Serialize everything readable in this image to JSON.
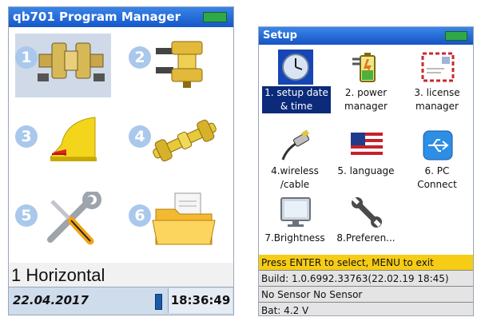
{
  "left_screen": {
    "title": "qb701 Program Manager",
    "tiles": [
      {
        "number": "1"
      },
      {
        "number": "2"
      },
      {
        "number": "3"
      },
      {
        "number": "4"
      },
      {
        "number": "5"
      },
      {
        "number": "6"
      }
    ],
    "selected_program": "1 Horizontal",
    "date": "22.04.2017",
    "time": "18:36:49"
  },
  "right_screen": {
    "title": "Setup",
    "items": [
      {
        "label_line1": "1. setup date",
        "label_line2": "& time",
        "icon": "clock-icon"
      },
      {
        "label_line1": "2. power",
        "label_line2": "manager",
        "icon": "power-battery-icon"
      },
      {
        "label_line1": "3. license",
        "label_line2": "manager",
        "icon": "license-envelope-icon"
      },
      {
        "label_line1": "4.wireless",
        "label_line2": "/cable",
        "icon": "cable-icon"
      },
      {
        "label_line1": "5. language",
        "label_line2": "",
        "icon": "flag-icon"
      },
      {
        "label_line1": "6. PC",
        "label_line2": "Connect",
        "icon": "usb-icon"
      },
      {
        "label_line1": "7.Brightness",
        "label_line2": "",
        "icon": "monitor-icon"
      },
      {
        "label_line1": "8.Preferen...",
        "label_line2": "",
        "icon": "wrench-icon"
      }
    ],
    "hint": "Press ENTER to select, MENU to exit",
    "build": "Build: 1.0.6992.33763(22.02.19 18:45)",
    "sensor": "No Sensor No Sensor",
    "battery_text": "Bat: 4.2 V"
  },
  "colors": {
    "titlebar": "#1e63d6",
    "hint_bar": "#f6cc15",
    "selected_label": "#0b2a7a",
    "tile_number": "#a9c8ec"
  }
}
